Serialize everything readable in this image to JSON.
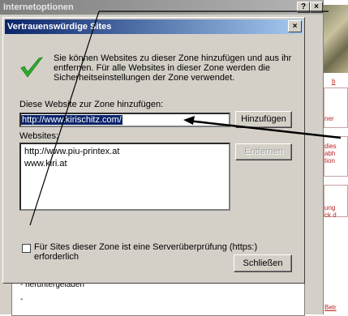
{
  "parent": {
    "title": "Internetoptionen",
    "help_label": "?",
    "close_label": "×",
    "lower_lines": [
      "-  heruntergeladen",
      "-"
    ]
  },
  "webpage": {
    "snippets": [
      "ner",
      "dies",
      "abh",
      "tion",
      "ung",
      "ck d",
      "Betr"
    ],
    "link_marker": "b"
  },
  "dialog": {
    "title": "Vertrauenswürdige Sites",
    "close_label": "×",
    "description": "Sie können Websites zu dieser Zone hinzufügen und aus ihr entfernen. Für alle Websites in dieser Zone werden die Sicherheitseinstellungen der Zone verwendet.",
    "add_label": "Diese Website zur Zone hinzufügen:",
    "add_value": "http://www.kirischitz.com/",
    "add_button": "Hinzufügen",
    "websites_label": "Websites:",
    "websites": [
      "http://www.piu-printex.at",
      "www.kiri.at"
    ],
    "remove_button": "Entfernen",
    "https_label": "Für Sites dieser Zone ist eine Serverüberprüfung (https:) erforderlich",
    "https_checked": false,
    "close_button": "Schließen"
  }
}
